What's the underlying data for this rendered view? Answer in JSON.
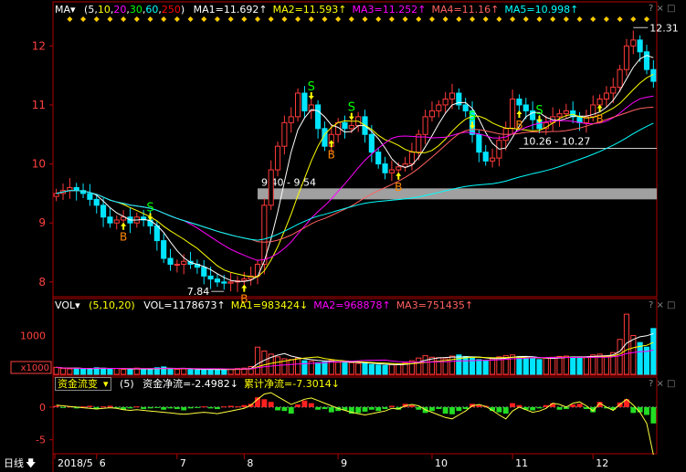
{
  "main_header": {
    "name": "MA",
    "params": [
      "5",
      "10",
      "20",
      "30",
      "60",
      "250"
    ],
    "param_colors": [
      "#ffffff",
      "#ffff00",
      "#ff00ff",
      "#00ff00",
      "#00ffff",
      "#ff0000"
    ],
    "items": [
      {
        "label": "MA1=11.692",
        "arrow": "↑",
        "color": "#ffffff"
      },
      {
        "label": "MA2=11.593",
        "arrow": "↑",
        "color": "#ffff00"
      },
      {
        "label": "MA3=11.252",
        "arrow": "↑",
        "color": "#ff00ff"
      },
      {
        "label": "MA4=11.16",
        "arrow": "↑",
        "color": "#ff6060"
      },
      {
        "label": "MA5=10.998",
        "arrow": "↑",
        "color": "#00ffff"
      }
    ]
  },
  "vol_header": {
    "name": "VOL",
    "params": [
      "5",
      "10",
      "20"
    ],
    "items": [
      {
        "label": "VOL=1178673",
        "arrow": "↑",
        "color": "#ffffff"
      },
      {
        "label": "MA1=983424",
        "arrow": "↓",
        "color": "#ffff00"
      },
      {
        "label": "MA2=968878",
        "arrow": "↑",
        "color": "#ff00ff"
      },
      {
        "label": "MA3=751435",
        "arrow": "↑",
        "color": "#ff6060"
      }
    ]
  },
  "flow_header": {
    "name": "资金流变",
    "param": "(5)",
    "items": [
      {
        "label": "资金净流=-2.4982",
        "arrow": "↓",
        "color": "#ffffff"
      },
      {
        "label": "累计净流=-7.3014",
        "arrow": "↓",
        "color": "#ffff00"
      }
    ]
  },
  "toolbar_glyphs": "? × □",
  "bottom": {
    "period_label": "日线",
    "arrow": "🡇",
    "months": [
      "2018/5",
      "6",
      "7",
      "8",
      "9",
      "10",
      "11",
      "12"
    ]
  },
  "annotations": {
    "high": "12.31",
    "low": "7.84",
    "gap1": "9.40 - 9.54",
    "gap2": "10.26 - 10.27",
    "vol_unit": "x1000"
  },
  "chart_data": [
    {
      "type": "candlestick",
      "y_ticks": [
        "12",
        "11",
        "10",
        "9",
        "8"
      ],
      "ylim": [
        7.75,
        12.5
      ],
      "x_months": [
        "2018/5",
        "6",
        "7",
        "8",
        "9",
        "10",
        "11",
        "12"
      ],
      "close_series": [
        9.5,
        9.55,
        9.6,
        9.55,
        9.5,
        9.4,
        9.3,
        9.1,
        9.0,
        9.05,
        9.1,
        9.0,
        9.1,
        9.05,
        8.95,
        8.7,
        8.4,
        8.3,
        8.3,
        8.35,
        8.3,
        8.25,
        8.1,
        8.05,
        8.0,
        7.98,
        8.0,
        8.02,
        8.05,
        8.1,
        8.3,
        9.3,
        9.9,
        10.3,
        10.7,
        10.8,
        11.2,
        10.9,
        11.0,
        10.6,
        10.3,
        10.5,
        10.7,
        10.6,
        10.65,
        10.8,
        10.5,
        10.2,
        10.0,
        9.85,
        9.9,
        9.95,
        10.0,
        10.2,
        10.5,
        10.8,
        10.9,
        11.0,
        11.1,
        11.2,
        11.0,
        10.9,
        10.5,
        10.2,
        10.05,
        10.1,
        10.4,
        10.6,
        11.1,
        11.0,
        10.9,
        10.75,
        10.6,
        10.7,
        10.8,
        10.85,
        10.9,
        10.8,
        10.7,
        10.8,
        11.0,
        11.1,
        11.2,
        11.3,
        11.6,
        12.0,
        12.1,
        11.9,
        11.6,
        11.4
      ],
      "ma_values": {
        "MA1": 11.692,
        "MA2": 11.593,
        "MA3": 11.252,
        "MA4": 11.16,
        "MA5": 10.998
      },
      "signals": [
        {
          "i": 10,
          "t": "B"
        },
        {
          "i": 14,
          "t": "S"
        },
        {
          "i": 28,
          "t": "B"
        },
        {
          "i": 38,
          "t": "S"
        },
        {
          "i": 41,
          "t": "B"
        },
        {
          "i": 44,
          "t": "S"
        },
        {
          "i": 51,
          "t": "B"
        },
        {
          "i": 62,
          "t": "S"
        },
        {
          "i": 69,
          "t": "B"
        },
        {
          "i": 72,
          "t": "S"
        },
        {
          "i": 81,
          "t": "B"
        }
      ]
    },
    {
      "type": "bar",
      "name": "VOL",
      "y_ticks": [
        "1000"
      ],
      "ylim": [
        0,
        1600
      ],
      "values": [
        180,
        150,
        140,
        160,
        130,
        150,
        170,
        160,
        140,
        150,
        130,
        120,
        160,
        140,
        130,
        170,
        190,
        150,
        130,
        140,
        120,
        110,
        130,
        140,
        120,
        110,
        130,
        150,
        160,
        200,
        700,
        600,
        520,
        450,
        400,
        380,
        420,
        350,
        340,
        300,
        320,
        360,
        310,
        290,
        300,
        280,
        300,
        250,
        240,
        230,
        250,
        260,
        300,
        350,
        420,
        480,
        440,
        430,
        400,
        470,
        500,
        460,
        420,
        380,
        360,
        400,
        450,
        480,
        500,
        460,
        420,
        400,
        380,
        420,
        440,
        460,
        470,
        450,
        430,
        450,
        500,
        520,
        480,
        560,
        900,
        1550,
        1000,
        820,
        700,
        1180
      ]
    },
    {
      "type": "bar",
      "name": "资金流变",
      "y_ticks": [
        "0",
        "-5"
      ],
      "ylim": [
        -7,
        2.5
      ],
      "values": [
        0.2,
        -0.1,
        0.1,
        -0.2,
        0.1,
        0.2,
        -0.3,
        0.1,
        0.2,
        -0.1,
        -0.4,
        -0.2,
        0.1,
        -0.3,
        -0.2,
        -0.1,
        -0.4,
        -0.2,
        -0.3,
        -0.5,
        -0.2,
        -0.1,
        0.1,
        -0.2,
        -0.3,
        0.1,
        0.2,
        0.1,
        0.3,
        0.5,
        1.5,
        1.2,
        0.8,
        -0.5,
        -0.6,
        -1.0,
        0.4,
        1.0,
        0.6,
        -0.4,
        -0.3,
        -0.8,
        -0.6,
        -0.5,
        -1.0,
        -0.9,
        -0.7,
        -0.4,
        -0.6,
        -0.3,
        0.2,
        -0.4,
        0.5,
        0.3,
        -0.4,
        -0.9,
        -0.6,
        -0.3,
        -1.0,
        -1.1,
        -0.6,
        -0.3,
        0.5,
        0.3,
        0.2,
        -0.6,
        -0.8,
        -1.0,
        0.6,
        0.3,
        -0.4,
        -0.5,
        -0.2,
        0.3,
        0.6,
        -0.4,
        -0.3,
        0.4,
        0.5,
        -0.3,
        -0.8,
        0.8,
        -0.2,
        -0.4,
        0.7,
        1.2,
        -0.9,
        -0.8,
        -1.2,
        -2.5
      ],
      "line_values": [
        0.3,
        0.2,
        0.1,
        0.0,
        -0.1,
        -0.2,
        -0.3,
        -0.2,
        -0.1,
        -0.2,
        -0.4,
        -0.5,
        -0.4,
        -0.5,
        -0.6,
        -0.7,
        -0.8,
        -0.9,
        -1.0,
        -1.1,
        -1.0,
        -0.9,
        -0.8,
        -0.9,
        -1.0,
        -0.8,
        -0.6,
        -0.4,
        -0.2,
        0.3,
        1.2,
        2.0,
        2.2,
        1.6,
        1.0,
        0.4,
        0.8,
        1.2,
        1.4,
        1.0,
        0.6,
        0.2,
        -0.2,
        -0.5,
        -0.8,
        -1.0,
        -1.2,
        -1.0,
        -0.8,
        -0.6,
        -0.2,
        -0.3,
        0.2,
        0.4,
        0.2,
        -0.4,
        -0.8,
        -1.2,
        -1.6,
        -1.8,
        -1.2,
        -0.6,
        0.2,
        0.4,
        0.1,
        -0.5,
        -1.2,
        -1.8,
        -0.6,
        0.0,
        -0.4,
        -0.8,
        -0.6,
        -0.2,
        0.6,
        0.4,
        0.0,
        0.6,
        0.8,
        0.2,
        -0.6,
        0.6,
        0.0,
        -0.5,
        0.4,
        1.2,
        0.3,
        -0.8,
        -2.5,
        -7.3
      ]
    }
  ]
}
